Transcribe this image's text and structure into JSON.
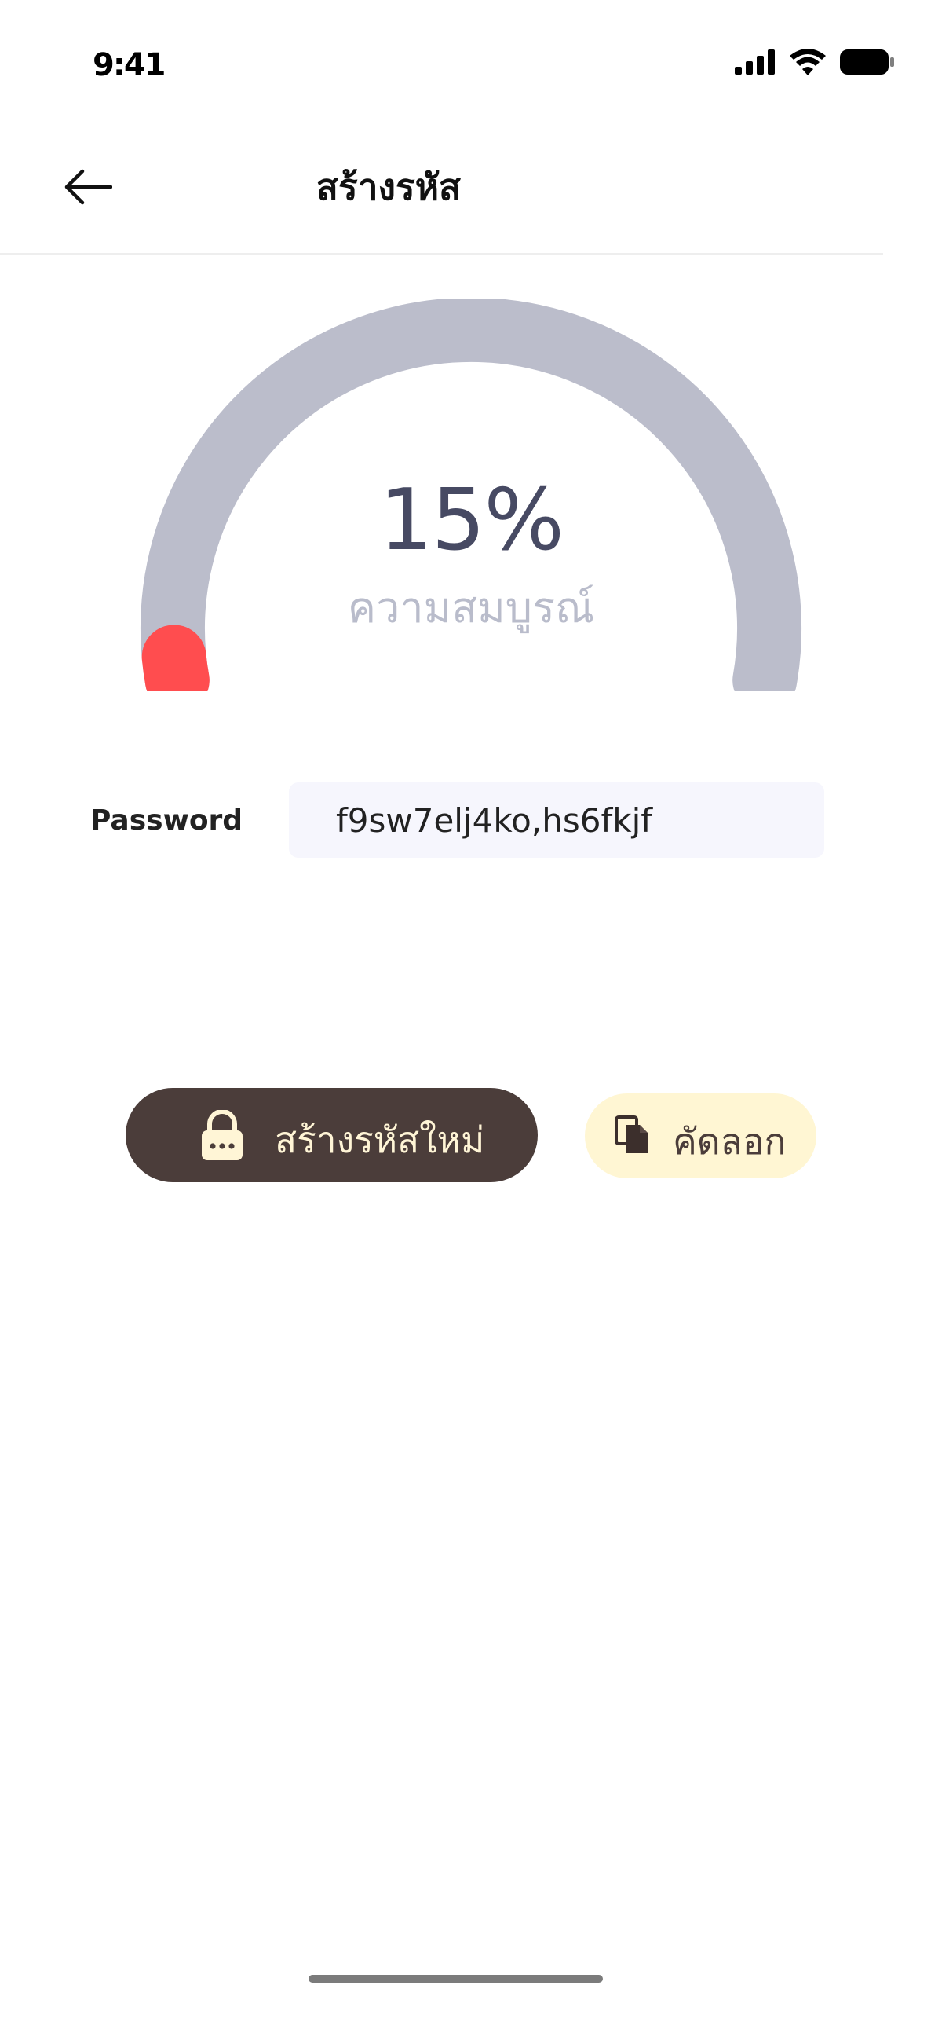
{
  "status_bar": {
    "time": "9:41",
    "icons": [
      "cellular-signal-icon",
      "wifi-icon",
      "battery-icon"
    ]
  },
  "header": {
    "title": "สร้างรหัส",
    "back_icon": "arrow-left-icon"
  },
  "gauge": {
    "percent_label": "15%",
    "percent_value": 15,
    "caption": "ความสมบูรณ์",
    "track_color": "#bbbdcb",
    "indicator_color": "#ff4d4f"
  },
  "password": {
    "label": "Password",
    "value": "f9sw7elj4ko,hs6fkjf"
  },
  "actions": {
    "generate_label": "สร้างรหัสใหม่",
    "generate_icon": "lock-icon",
    "copy_label": "คัดลอก",
    "copy_icon": "copy-icon"
  },
  "colors": {
    "primary_button": "#4b3d3a",
    "secondary_button": "#fff6d3",
    "primary_button_text": "#fff5d6"
  }
}
